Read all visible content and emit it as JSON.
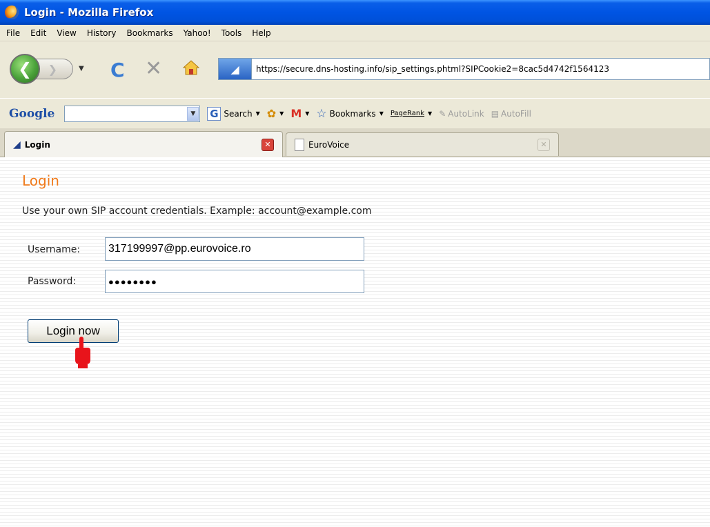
{
  "window": {
    "title": "Login - Mozilla Firefox"
  },
  "menu": {
    "items": [
      "File",
      "Edit",
      "View",
      "History",
      "Bookmarks",
      "Yahoo!",
      "Tools",
      "Help"
    ]
  },
  "nav": {
    "url": "https://secure.dns-hosting.info/sip_settings.phtml?SIPCookie2=8cac5d4742f1564123"
  },
  "google_toolbar": {
    "logo": "Google",
    "search_label": "Search",
    "bookmarks_label": "Bookmarks",
    "pagerank_label": "PageRank",
    "autolink_label": "AutoLink",
    "autofill_label": "AutoFill"
  },
  "tabs": [
    {
      "label": "Login",
      "active": true
    },
    {
      "label": "EuroVoice",
      "active": false
    }
  ],
  "page": {
    "title": "Login",
    "info": "Use your own SIP account credentials. Example: account@example.com",
    "username_label": "Username:",
    "username_value": "317199997@pp.eurovoice.ro",
    "password_label": "Password:",
    "password_mask": "●●●●●●●●",
    "login_button": "Login now"
  },
  "colors": {
    "title_accent": "#f07a1a",
    "titlebar_blue": "#0054e3"
  }
}
